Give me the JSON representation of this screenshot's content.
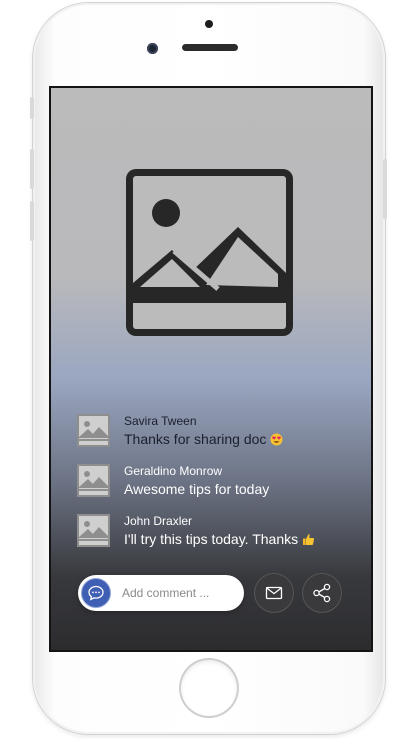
{
  "comments": [
    {
      "author": "Savira Tween",
      "text": "Thanks for sharing doc",
      "emoji": "heart-eyes"
    },
    {
      "author": "Geraldino Monrow",
      "text": "Awesome tips for today",
      "emoji": ""
    },
    {
      "author": "John Draxler",
      "text": "I'll try this tips today. Thanks",
      "emoji": "thumbs-up"
    }
  ],
  "composer": {
    "placeholder": "Add comment ...",
    "comment_icon": "comment-bubble-icon",
    "mail_icon": "mail-icon",
    "share_icon": "share-icon"
  },
  "media": {
    "icon": "image-placeholder-icon"
  },
  "colors": {
    "accent": "#3f5fb5",
    "bubble_btn": "#3a3a3d",
    "screen_top": "#bbbbbb",
    "screen_mid": "#9aa6c0",
    "screen_bottom": "#2c2c2f"
  }
}
